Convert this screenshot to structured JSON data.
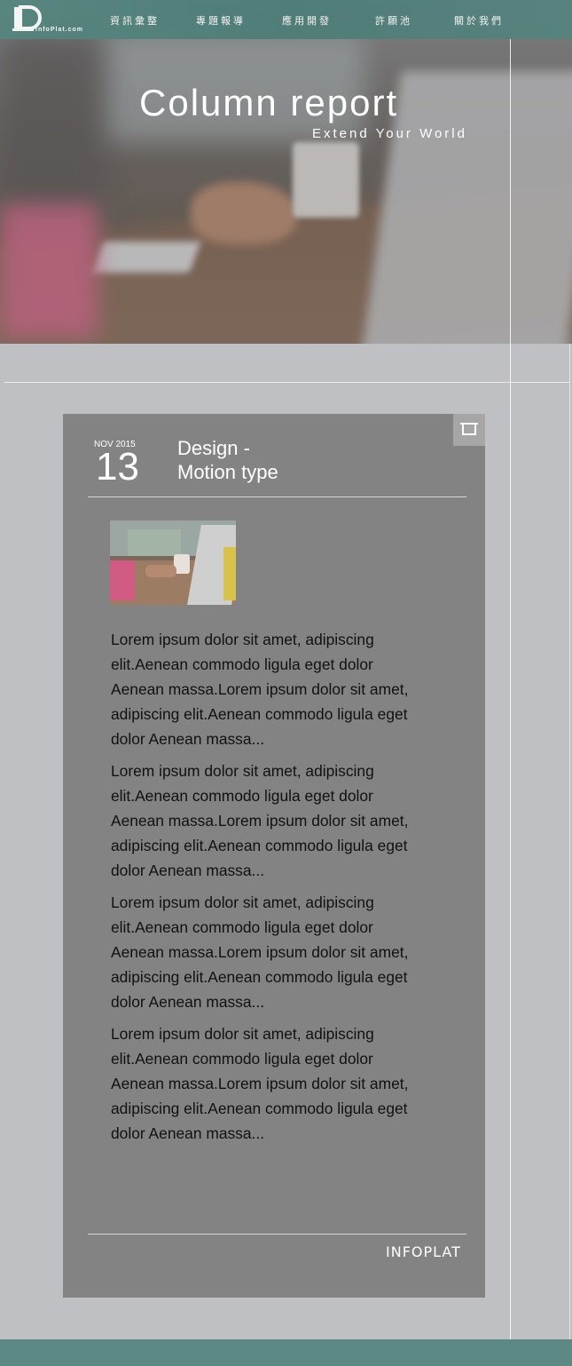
{
  "header": {
    "logo_text": "InfoPlat.com",
    "nav": [
      "資訊彙整",
      "專題報導",
      "應用開發",
      "許願池",
      "關於我們"
    ]
  },
  "hero": {
    "title": "Column report",
    "subtitle": "Extend Your World"
  },
  "post": {
    "month_year": "NOV 2015",
    "day": "13",
    "title_line1": "Design -",
    "title_line2": "Motion type",
    "paragraphs": [
      "Lorem ipsum dolor sit amet, adipiscing elit.Aenean commodo ligula eget dolor Aenean massa.Lorem ipsum dolor sit amet, adipiscing elit.Aenean commodo ligula eget dolor Aenean massa...",
      "Lorem ipsum dolor sit amet, adipiscing elit.Aenean commodo ligula eget dolor Aenean massa.Lorem ipsum dolor sit amet, adipiscing elit.Aenean commodo ligula eget dolor Aenean massa...",
      "Lorem ipsum dolor sit amet, adipiscing elit.Aenean commodo ligula eget dolor Aenean massa.Lorem ipsum dolor sit amet, adipiscing elit.Aenean commodo ligula eget dolor Aenean massa...",
      "Lorem ipsum dolor sit amet, adipiscing elit.Aenean commodo ligula eget dolor Aenean massa.Lorem ipsum dolor sit amet, adipiscing elit.Aenean commodo ligula eget dolor Aenean massa..."
    ],
    "brand": "INFOPLAT",
    "bookmark_icon": "bookmark-icon"
  },
  "colors": {
    "topbar": "#4d7d78",
    "card": "#848383",
    "page_bg": "#bfc0c3",
    "footer": "#5d8984"
  }
}
